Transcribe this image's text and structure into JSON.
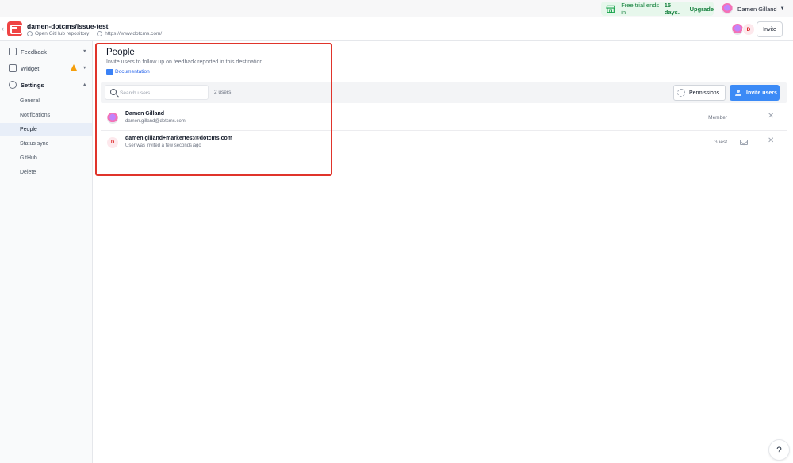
{
  "topbar": {
    "trial_prefix": "Free trial ends in",
    "trial_days": "15 days.",
    "trial_upgrade": "Upgrade",
    "user_name": "Damen Gilland"
  },
  "project": {
    "name": "damen-dotcms/issue-test",
    "repo_link": "Open GitHub repository",
    "site_url": "https://www.dotcms.com/",
    "invite_label": "Invite",
    "avatar_initial": "D"
  },
  "sidebar": {
    "feedback": "Feedback",
    "widget": "Widget",
    "settings": "Settings",
    "items": [
      "General",
      "Notifications",
      "People",
      "Status sync",
      "GitHub",
      "Delete"
    ],
    "active": "People"
  },
  "main": {
    "title": "People",
    "description": "Invite users to follow up on feedback reported in this destination.",
    "doc_link": "Documentation",
    "search_placeholder": "Search users...",
    "user_count": "2 users",
    "permissions_label": "Permissions",
    "invite_users_label": "Invite users"
  },
  "users": [
    {
      "name": "Damen Gilland",
      "sub": "damen.gilland@dotcms.com",
      "role": "Member"
    },
    {
      "name": "damen.gilland+markertest@dotcms.com",
      "sub": "User was invited a few seconds ago",
      "role": "Guest",
      "initial": "D"
    }
  ],
  "help_label": "?",
  "colors": {
    "accent": "#3b8af6",
    "brand": "#ef4444",
    "highlight": "#e0342b",
    "trial_bg": "#e7f7ec"
  }
}
